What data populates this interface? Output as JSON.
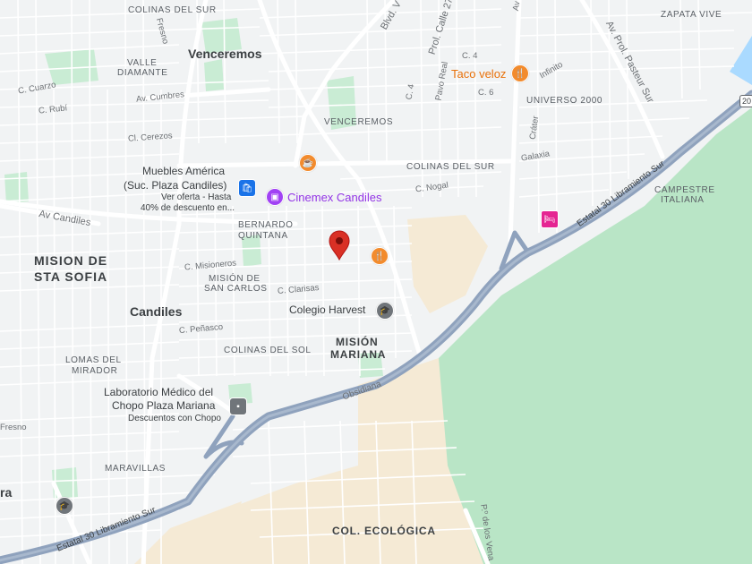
{
  "colors": {
    "land": "#f1f3f4",
    "park": "#c9ecd4",
    "green_big": "#b9e5c6",
    "sand": "#f5ead5",
    "highway": "#8fa2bd",
    "road": "#ffffff",
    "water": "#aadaff",
    "pin": "#d93025",
    "orange": "#f28b2d",
    "purple": "#a142f4",
    "blue": "#1a73e8",
    "gray_poi": "#70757a",
    "pink": "#e52592"
  },
  "areas": {
    "colinas_del_sur_top": "COLINAS DEL SUR",
    "zapata_vive": "ZAPATA VIVE",
    "valle_diamante": [
      "VALLE",
      "DIAMANTE"
    ],
    "venceremos_area": "VENCEREMOS",
    "colinas_del_sur_mid": "COLINAS DEL SUR",
    "universo_2000": "UNIVERSO 2000",
    "campestre_italiana": [
      "CAMPESTRE",
      "ITALIANA"
    ],
    "bernardo_quintana": [
      "BERNARDO",
      "QUINTANA"
    ],
    "mision_de_sta_sofia": [
      "MISION DE",
      "STA SOFIA"
    ],
    "mision_de_san_carlos": [
      "MISIÓN DE",
      "SAN CARLOS"
    ],
    "colinas_del_sol": "COLINAS DEL SOL",
    "mision_mariana": [
      "MISIÓN",
      "MARIANA"
    ],
    "lomas_del_mirador": [
      "LOMAS DEL",
      "MIRADOR"
    ],
    "maravillas": "MARAVILLAS",
    "col_ecologica": "COL. ECOLÓGICA"
  },
  "cities": {
    "venceremos": "Venceremos",
    "candiles": "Candiles"
  },
  "streets": {
    "c_cuarzo": "C. Cuarzo",
    "c_rubi": "C. Rubí",
    "av_cumbres": "Av. Cumbres",
    "cl_cerezos": "Cl. Cerezos",
    "av_candiles": "Av Candiles",
    "fresno_top": "Fresno",
    "c_misioneros": "C. Misioneros",
    "c_clarisas": "C. Clarisas",
    "c_penasco": "C. Peñasco",
    "fresno_left": "Fresno",
    "obsidiana": "Obsidiana",
    "estatal_30_upper": "Estatal 30 Libramiento Sur",
    "estatal_30_lower": "Estatal 30 Libramiento Sur",
    "blvd": "Blvd. V",
    "prol_calle_27": "Prol. Calle 27",
    "pavo_real": "Pavo Real",
    "c_4a": "C. 4",
    "c_4b": "C. 4",
    "c_6": "C. 6",
    "c_nogal": "C. Nogal",
    "infinito": "Infinito",
    "crater": "Cráter",
    "galaxia": "Galaxia",
    "av_prol_pasteur_sur": "Av. Prol. Pasteur Sur",
    "av_top": "Av",
    "p_de_los_vena": "P.º de los Vena"
  },
  "pois": {
    "muebles": {
      "line1": "Muebles América",
      "line2": "(Suc. Plaza Candiles)",
      "offer1": "Ver oferta - Hasta",
      "offer2": "40% de descuento en..."
    },
    "cinemex": "Cinemex Candiles",
    "taco_veloz": "Taco veloz",
    "colegio_harvest": "Colegio Harvest",
    "laboratorio": {
      "line1": "Laboratorio Médico del",
      "line2": "Chopo Plaza Mariana",
      "sub": "Descuentos con Chopo"
    },
    "left_edge_label": "ra"
  },
  "shields": {
    "route_20": "20"
  }
}
